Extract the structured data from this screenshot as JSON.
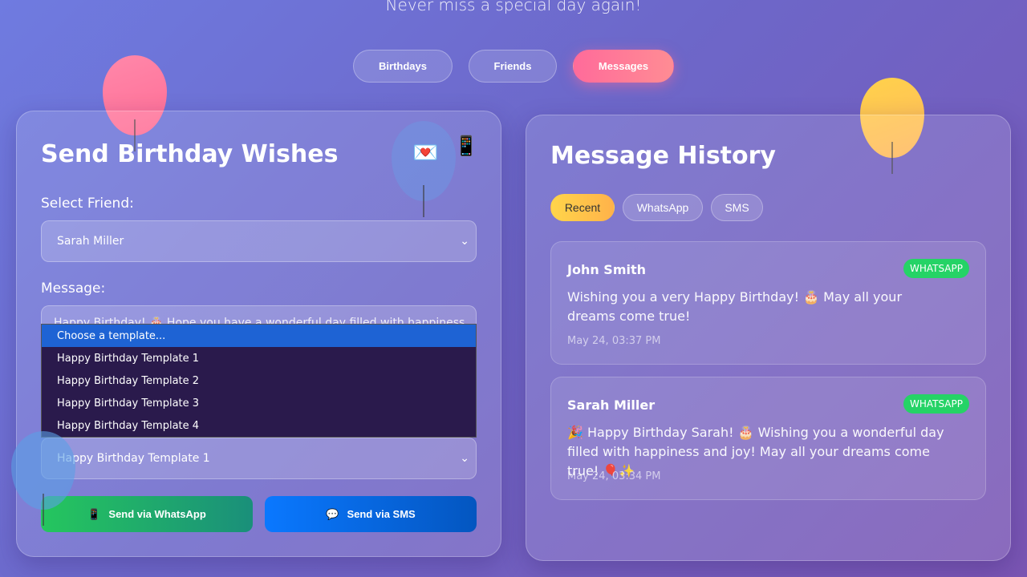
{
  "header": {
    "subtitle": "Never miss a special day again!"
  },
  "nav": {
    "tabs": [
      {
        "label": "Birthdays",
        "active": false
      },
      {
        "label": "Friends",
        "active": false
      },
      {
        "label": "Messages",
        "active": true
      }
    ]
  },
  "send": {
    "title": "Send Birthday Wishes",
    "decor_icons": [
      "💌",
      "📱"
    ],
    "friend_label": "Select Friend:",
    "friend_value": "Sarah Miller",
    "message_label": "Message:",
    "message_value": "Happy Birthday! 🎂 Hope you have a wonderful day filled with happiness",
    "template_dropdown": {
      "options": [
        "Choose a template...",
        "Happy Birthday Template 1",
        "Happy Birthday Template 2",
        "Happy Birthday Template 3",
        "Happy Birthday Template 4"
      ],
      "highlighted_index": 0
    },
    "template_value": "Happy Birthday Template 1",
    "whatsapp_btn": {
      "icon": "📱",
      "label": "Send via WhatsApp"
    },
    "sms_btn": {
      "icon": "💬",
      "label": "Send via SMS"
    }
  },
  "history": {
    "title": "Message History",
    "filters": [
      {
        "label": "Recent",
        "active": true
      },
      {
        "label": "WhatsApp",
        "active": false
      },
      {
        "label": "SMS",
        "active": false
      }
    ],
    "messages": [
      {
        "name": "John Smith",
        "channel": "WHATSAPP",
        "text": "Wishing you a very Happy Birthday! 🎂 May all your dreams come true!",
        "time": "May 24, 03:37 PM"
      },
      {
        "name": "Sarah Miller",
        "channel": "WHATSAPP",
        "text": "🎉 Happy Birthday Sarah! 🎂 Wishing you a wonderful day filled with happiness and joy! May all your dreams come true! 🎈✨",
        "time": "May 24, 03:34 PM"
      }
    ]
  },
  "colors": {
    "accent_pink": "#ff6b9a",
    "accent_yellow": "#ffc94a",
    "whatsapp_green": "#25d366",
    "sms_blue": "#0a6cf5"
  }
}
